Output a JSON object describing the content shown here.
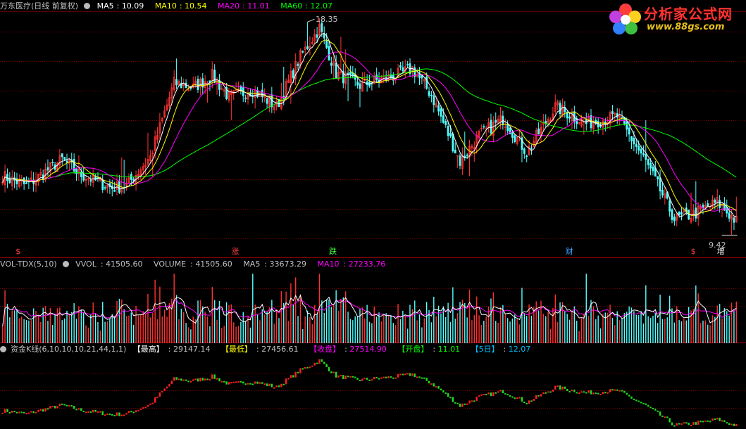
{
  "chart_data": [
    {
      "type": "candlestick",
      "title": "万东医疗(日线 前复权)",
      "indicators": [
        {
          "name": "MA5",
          "value": "10.09",
          "color": "#ffffff"
        },
        {
          "name": "MA10",
          "value": "10.54",
          "color": "#ffff00"
        },
        {
          "name": "MA20",
          "value": "11.01",
          "color": "#ff00ff"
        },
        {
          "name": "MA60",
          "value": "12.07",
          "color": "#00ff00"
        }
      ],
      "ylim": [
        8.9,
        18.8
      ],
      "high_label": "18.35",
      "low_label": "9.42",
      "high": 18.35,
      "low": 9.42,
      "markers": [
        {
          "text": "$",
          "color": "#ff4040",
          "x_frac": 0.021
        },
        {
          "text": "涨",
          "color": "#ff4040",
          "x_frac": 0.31
        },
        {
          "text": "跌",
          "color": "#40ff40",
          "x_frac": 0.441
        },
        {
          "text": "财",
          "color": "#40a0ff",
          "x_frac": 0.758
        },
        {
          "text": "$",
          "color": "#ff4040",
          "x_frac": 0.926
        },
        {
          "text": "增",
          "color": "#ffffff",
          "x_frac": 0.961
        }
      ],
      "anchors": [
        [
          0,
          11.9
        ],
        [
          10,
          11.5
        ],
        [
          25,
          12.6
        ],
        [
          32,
          12.0
        ],
        [
          46,
          11.4
        ],
        [
          52,
          11.5
        ],
        [
          62,
          12.7
        ],
        [
          72,
          15.8
        ],
        [
          80,
          15.6
        ],
        [
          88,
          16.1
        ],
        [
          95,
          15.2
        ],
        [
          105,
          15.5
        ],
        [
          115,
          14.8
        ],
        [
          125,
          16.9
        ],
        [
          133,
          18.1
        ],
        [
          140,
          16.2
        ],
        [
          150,
          15.7
        ],
        [
          165,
          16.1
        ],
        [
          172,
          16.4
        ],
        [
          180,
          15.3
        ],
        [
          192,
          12.5
        ],
        [
          200,
          13.6
        ],
        [
          210,
          14.3
        ],
        [
          220,
          12.9
        ],
        [
          232,
          14.8
        ],
        [
          245,
          14.1
        ],
        [
          258,
          14.4
        ],
        [
          270,
          12.5
        ],
        [
          282,
          10.1
        ],
        [
          290,
          10.3
        ],
        [
          300,
          10.8
        ],
        [
          308,
          10.0
        ]
      ]
    },
    {
      "type": "volume",
      "title": "VOL-TDX(5,10)",
      "indicators": [
        {
          "name": "VVOL",
          "value": "41505.60",
          "color": "#c0c0c0"
        },
        {
          "name": "VOLUME",
          "value": "41505.60",
          "color": "#c0c0c0"
        },
        {
          "name": "MA5",
          "value": "33673.29",
          "color": "#c0c0c0"
        },
        {
          "name": "MA10",
          "value": "27233.76",
          "color": "#ff00ff"
        }
      ]
    },
    {
      "type": "candlestick",
      "title": "资金K线(6,10,10,10,21,44,1,1)",
      "indicators": [
        {
          "name": "【最高】",
          "value": "29147.14",
          "color": "#ffffff"
        },
        {
          "name": "【最低】",
          "value": "27456.61",
          "color": "#ffff00"
        },
        {
          "name": "【收盘】",
          "value": "27514.90",
          "color": "#ff00ff"
        },
        {
          "name": "【开盘】",
          "value": "11.01",
          "color": "#00ff00"
        },
        {
          "name": "【5日】",
          "value": "12.07",
          "color": "#00c0ff"
        }
      ]
    }
  ],
  "logo": {
    "name": "分析家公式网",
    "url": "www.88gs.com"
  },
  "colors": {
    "up": "#ff3232",
    "down": "#54ffff",
    "fund_up": "#ff2020",
    "fund_down": "#20e020",
    "grid": "#8b0000",
    "axis": "#a00000"
  }
}
